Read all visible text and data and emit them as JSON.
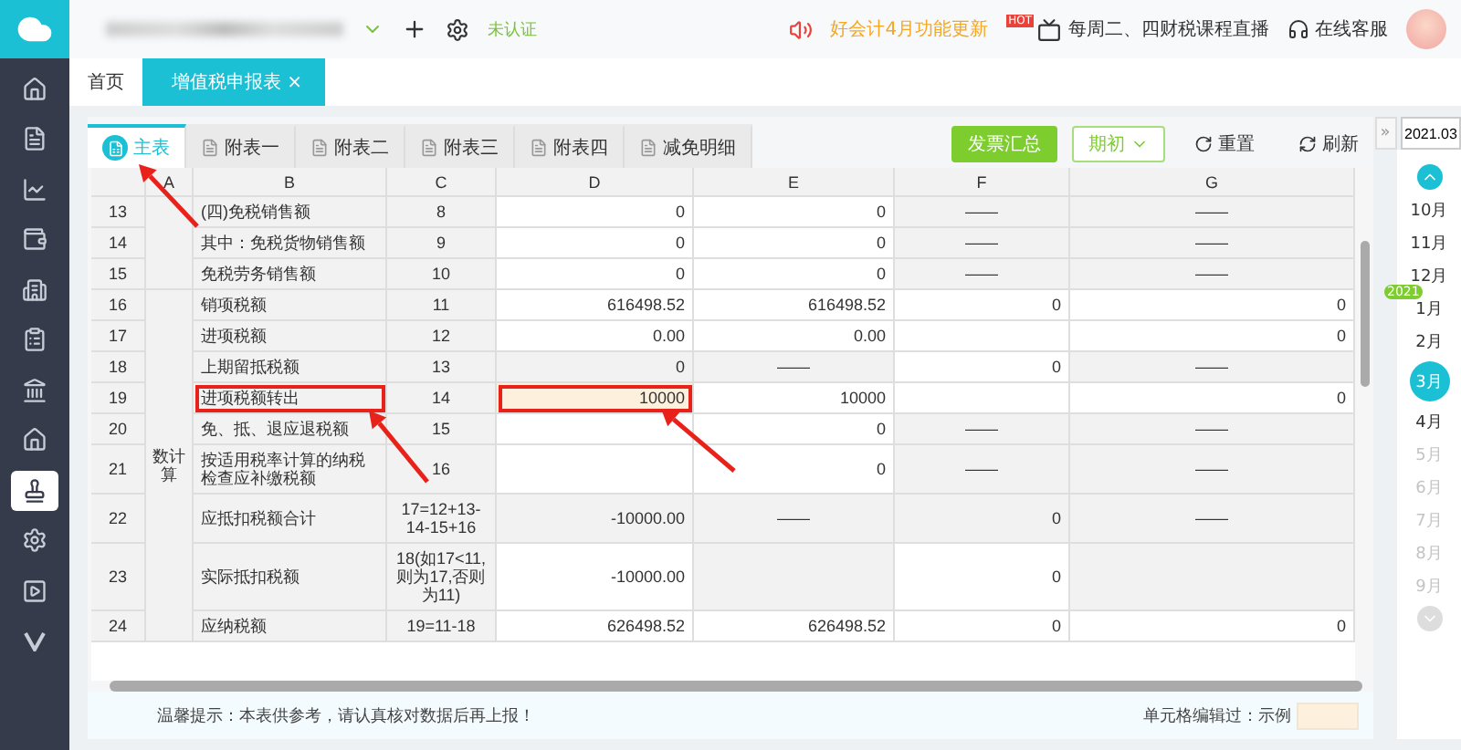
{
  "sidebar": {
    "items": [
      {
        "selected": false
      },
      {
        "selected": false
      },
      {
        "selected": false
      },
      {
        "selected": false
      },
      {
        "selected": false
      },
      {
        "selected": false
      },
      {
        "selected": false
      },
      {
        "selected": false
      },
      {
        "selected": true
      },
      {
        "selected": false
      },
      {
        "selected": false
      },
      {
        "selected": false
      }
    ]
  },
  "topbar": {
    "status": "未认证",
    "announcement": "好会计4月功能更新",
    "live_badge": "HOT",
    "live": "每周二、四财税课程直播",
    "support": "在线客服"
  },
  "tabs": [
    {
      "label": "首页",
      "selected": false
    },
    {
      "label": "增值税申报表",
      "selected": true,
      "close": "×"
    }
  ],
  "sheet_tabs": [
    {
      "label": "主表",
      "selected": true
    },
    {
      "label": "附表一",
      "selected": false
    },
    {
      "label": "附表二",
      "selected": false
    },
    {
      "label": "附表三",
      "selected": false
    },
    {
      "label": "附表四",
      "selected": false
    },
    {
      "label": "减免明细",
      "selected": false
    }
  ],
  "toolbar": [
    {
      "kind": "primary",
      "label": "发票汇总"
    },
    {
      "kind": "dropdown",
      "label": "期初"
    },
    {
      "kind": "reset",
      "label": "重置"
    },
    {
      "kind": "refresh",
      "label": "刷新"
    }
  ],
  "table": {
    "group_column": "A",
    "columns": [
      "B",
      "C",
      "D",
      "E",
      "F",
      "G"
    ],
    "rows": [
      {
        "number": "13",
        "group_start": true,
        "cells": [
          {
            "text": "(四)免税销售额",
            "shaded": true
          },
          {
            "text": "8",
            "shaded": true
          },
          {
            "text": "0",
            "shaded": false
          },
          {
            "text": "0",
            "shaded": false
          },
          {
            "text": "——",
            "shaded": true
          },
          {
            "text": "——",
            "shaded": true
          }
        ]
      },
      {
        "number": "14",
        "group_start": false,
        "cells": [
          {
            "text": "其中：免税货物销售额",
            "shaded": true
          },
          {
            "text": "9",
            "shaded": true
          },
          {
            "text": "0",
            "shaded": false
          },
          {
            "text": "0",
            "shaded": false
          },
          {
            "text": "——",
            "shaded": true
          },
          {
            "text": "——",
            "shaded": true
          }
        ]
      },
      {
        "number": "15",
        "group_start": false,
        "cells": [
          {
            "text": "免税劳务销售额",
            "shaded": true
          },
          {
            "text": "10",
            "shaded": true
          },
          {
            "text": "0",
            "shaded": false
          },
          {
            "text": "0",
            "shaded": false
          },
          {
            "text": "——",
            "shaded": true
          },
          {
            "text": "——",
            "shaded": true
          }
        ]
      },
      {
        "number": "16",
        "group_start": true,
        "group_label": "数计算",
        "cells": [
          {
            "text": "销项税额",
            "shaded": true
          },
          {
            "text": "11",
            "shaded": true
          },
          {
            "text": "616498.52",
            "shaded": false
          },
          {
            "text": "616498.52",
            "shaded": false
          },
          {
            "text": "0",
            "shaded": false
          },
          {
            "text": "0",
            "shaded": false
          }
        ]
      },
      {
        "number": "17",
        "group_start": false,
        "cells": [
          {
            "text": "进项税额",
            "shaded": true
          },
          {
            "text": "12",
            "shaded": true
          },
          {
            "text": "0.00",
            "shaded": false
          },
          {
            "text": "0.00",
            "shaded": false
          },
          {
            "shaded": false
          },
          {
            "text": "0",
            "shaded": false
          }
        ]
      },
      {
        "number": "18",
        "group_start": false,
        "cells": [
          {
            "text": "上期留抵税额",
            "shaded": true
          },
          {
            "text": "13",
            "shaded": true
          },
          {
            "text": "0",
            "shaded": true
          },
          {
            "text": "——",
            "shaded": true
          },
          {
            "text": "0",
            "shaded": false
          },
          {
            "text": "——",
            "shaded": true
          }
        ]
      },
      {
        "number": "19",
        "group_start": false,
        "cells": [
          {
            "text": "进项税额转出",
            "shaded": true,
            "annotated": true
          },
          {
            "text": "14",
            "shaded": true
          },
          {
            "text": "10000",
            "shaded": false,
            "edited": true,
            "annotated": true
          },
          {
            "text": "10000",
            "shaded": false
          },
          {
            "shaded": false
          },
          {
            "text": "0",
            "shaded": false
          }
        ]
      },
      {
        "number": "20",
        "group_start": false,
        "cells": [
          {
            "text": "免、抵、退应退税额",
            "shaded": true
          },
          {
            "text": "15",
            "shaded": true
          },
          {
            "shaded": false
          },
          {
            "text": "0",
            "shaded": false
          },
          {
            "text": "——",
            "shaded": true
          },
          {
            "text": "——",
            "shaded": true
          }
        ]
      },
      {
        "number": "21",
        "group_start": false,
        "cells": [
          {
            "text": "按适用税率计算的纳税检查应补缴税额",
            "shaded": true
          },
          {
            "text": "16",
            "shaded": true
          },
          {
            "shaded": false
          },
          {
            "text": "0",
            "shaded": false
          },
          {
            "text": "——",
            "shaded": true
          },
          {
            "text": "——",
            "shaded": true
          }
        ]
      },
      {
        "number": "22",
        "group_start": false,
        "cells": [
          {
            "text": "应抵扣税额合计",
            "shaded": true
          },
          {
            "text": "17=12+13-14-15+16",
            "shaded": true
          },
          {
            "text": "-10000.00",
            "shaded": true
          },
          {
            "text": "——",
            "shaded": true
          },
          {
            "text": "0",
            "shaded": true
          },
          {
            "text": "——",
            "shaded": true
          }
        ]
      },
      {
        "number": "23",
        "group_start": false,
        "cells": [
          {
            "text": "实际抵扣税额",
            "shaded": true
          },
          {
            "text": "18(如17<11,则为17,否则为11)",
            "shaded": true
          },
          {
            "text": "-10000.00",
            "shaded": false
          },
          {
            "shaded": true
          },
          {
            "text": "0",
            "shaded": false
          },
          {
            "shaded": true
          }
        ]
      },
      {
        "number": "24",
        "group_start": false,
        "cells": [
          {
            "text": "应纳税额",
            "shaded": true
          },
          {
            "text": "19=11-18",
            "shaded": true
          },
          {
            "text": "626498.52",
            "shaded": false
          },
          {
            "text": "626498.52",
            "shaded": false
          },
          {
            "text": "0",
            "shaded": false
          },
          {
            "text": "0",
            "shaded": false
          }
        ]
      }
    ]
  },
  "footer": {
    "tip": "温馨提示：本表供参考，请认真核对数据后再上报！",
    "legend": "单元格编辑过：示例"
  },
  "calendar": {
    "collapse": "»",
    "period": "2021.03",
    "months": [
      {
        "label": "10月",
        "selected": false,
        "disabled": false
      },
      {
        "label": "11月",
        "selected": false,
        "disabled": false
      },
      {
        "label": "12月",
        "selected": false,
        "disabled": false
      },
      {
        "label": "1月",
        "selected": false,
        "disabled": false,
        "year_badge": "2021"
      },
      {
        "label": "2月",
        "selected": false,
        "disabled": false
      },
      {
        "label": "3月",
        "selected": true,
        "disabled": false
      },
      {
        "label": "4月",
        "selected": false,
        "disabled": false
      },
      {
        "label": "5月",
        "selected": false,
        "disabled": true
      },
      {
        "label": "6月",
        "selected": false,
        "disabled": true
      },
      {
        "label": "7月",
        "selected": false,
        "disabled": true
      },
      {
        "label": "8月",
        "selected": false,
        "disabled": true
      },
      {
        "label": "9月",
        "selected": false,
        "disabled": true
      }
    ]
  }
}
